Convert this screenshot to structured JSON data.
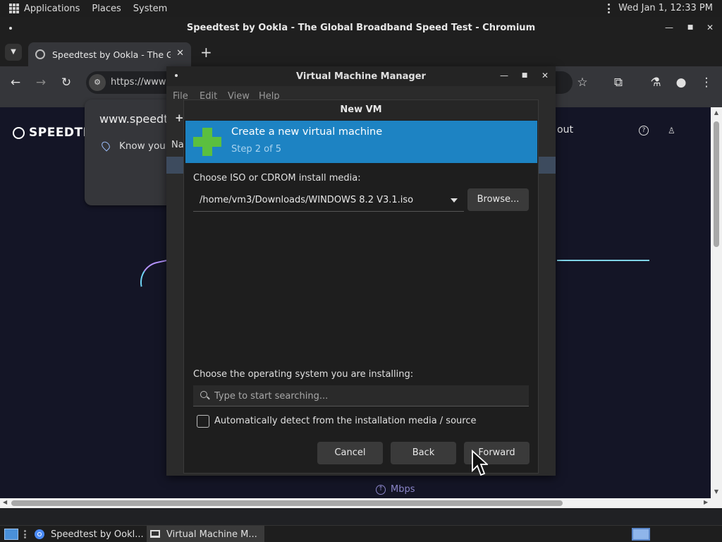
{
  "top_panel": {
    "menus": [
      "Applications",
      "Places",
      "System"
    ],
    "clock": "Wed Jan  1, 12:33 PM"
  },
  "browser": {
    "window_title": "Speedtest by Ookla - The Global Broadband Speed Test - Chromium",
    "tab_label": "Speedtest by Ookla - The Global Broadband Speed Test",
    "url": "https://www",
    "omnibox_dropdown": {
      "host": "www.speedt",
      "location_text": "Know your"
    },
    "page": {
      "logo": "SPEEDTE",
      "about": "out",
      "mbps": "Mbps"
    }
  },
  "vmm": {
    "title": "Virtual Machine Manager",
    "menu": [
      "File",
      "Edit",
      "View",
      "Help"
    ],
    "side_plus": "+",
    "side_name": "Na"
  },
  "new_vm": {
    "title": "New VM",
    "header": {
      "heading": "Create a new virtual machine",
      "step": "Step 2 of 5",
      "accent": "#1d83c3"
    },
    "install_media_label": "Choose ISO or CDROM install media:",
    "iso_path": "/home/vm3/Downloads/WINDOWS 8.2 V3.1.iso",
    "browse_label": "Browse...",
    "os_label": "Choose the operating system you are installing:",
    "os_search_placeholder": "Type to start searching...",
    "auto_detect_label": "Automatically detect from the installation media / source",
    "auto_detect_checked": false,
    "buttons": {
      "cancel": "Cancel",
      "back": "Back",
      "forward": "Forward"
    }
  },
  "taskbar": {
    "items": [
      "Speedtest by Ookl...",
      "Virtual Machine M..."
    ]
  }
}
